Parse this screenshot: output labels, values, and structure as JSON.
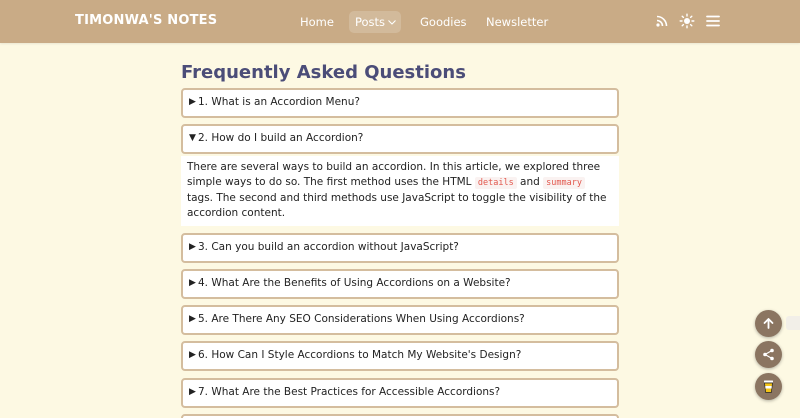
{
  "header": {
    "brand": "TIMONWA'S NOTES",
    "nav": [
      {
        "label": "Home"
      },
      {
        "label": "Posts"
      },
      {
        "label": "Goodies"
      },
      {
        "label": "Newsletter"
      }
    ],
    "icons": [
      "rss-icon",
      "sun-icon",
      "menu-icon"
    ]
  },
  "main": {
    "title": "Frequently Asked Questions",
    "accordions": [
      {
        "label": "1. What is an Accordion Menu?",
        "open": false
      },
      {
        "label": "2. How do I build an Accordion?",
        "open": true
      },
      {
        "label": "3. Can you build an accordion without JavaScript?",
        "open": false
      },
      {
        "label": "4. What Are the Benefits of Using Accordions on a Website?",
        "open": false
      },
      {
        "label": "5. Are There Any SEO Considerations When Using Accordions?",
        "open": false
      },
      {
        "label": "6. How Can I Style Accordions to Match My Website's Design?",
        "open": false
      },
      {
        "label": "7. What Are the Best Practices for Accessible Accordions?",
        "open": false
      }
    ],
    "answer": {
      "part1": "There are several ways to build an accordion. In this article, we explored three simple ways to do so. The first method uses the HTML",
      "code1": "details",
      "and": "and",
      "code2": "summary",
      "part2": "tags. The second and third methods use JavaScript to toggle the visibility of the accordion content."
    }
  },
  "markers": {
    "closed": "▶",
    "open": "▼"
  },
  "colors": {
    "header": "#c9ab86",
    "background": "#fdf9e3",
    "title": "#4b4d78",
    "accordion_border": "#d4bd9e",
    "fab": "#8b7561",
    "code": "#e2584e"
  }
}
